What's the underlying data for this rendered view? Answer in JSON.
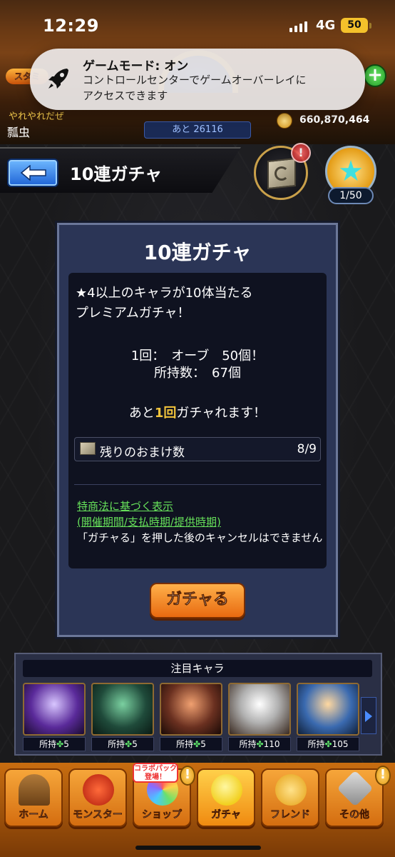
{
  "status_bar": {
    "time": "12:29",
    "network": "4G",
    "battery": "50"
  },
  "header": {
    "stamina_label": "スタミ",
    "subtitle": "やれやれだぜ",
    "username": "瓢虫",
    "remain_text": "あと 26116",
    "coins": "660,870,464"
  },
  "game_mode_banner": {
    "title": "ゲームモード: オン",
    "line1": "コントロールセンターでゲームオーバーレイに",
    "line2": "アクセスできます"
  },
  "title_bar": {
    "title": "10連ガチャ",
    "box_badge": "!",
    "star_count": "1/50"
  },
  "panel": {
    "title": "10連ガチャ",
    "desc_line1": "★4以上のキャラが10体当たる",
    "desc_line2": "プレミアムガチャ！",
    "cost_line": "1回：　オーブ　50個！",
    "owned_line": "所持数：　67個",
    "remaining_prefix": "あと",
    "remaining_count": "1回",
    "remaining_suffix": "ガチャれます！",
    "bonus_label": "残りのおまけ数",
    "bonus_value": "8/9",
    "legal_link1": "特商法に基づく表示",
    "legal_link2": "(開催期間/支払時期/提供時期)",
    "cancel_note": "「ガチャる」を押した後のキャンセルはできません",
    "gacha_button": "ガチャる"
  },
  "featured": {
    "title": "注目キャラ",
    "cards": [
      {
        "prefix": "所持",
        "clover": "✤",
        "count": "5"
      },
      {
        "prefix": "所持",
        "clover": "✤",
        "count": "5"
      },
      {
        "prefix": "所持",
        "clover": "✤",
        "count": "5"
      },
      {
        "prefix": "所持",
        "clover": "✤",
        "count": "110"
      },
      {
        "prefix": "所持",
        "clover": "✤",
        "count": "105"
      }
    ]
  },
  "bottom_nav": {
    "items": [
      {
        "label": "ホーム",
        "icon": "home-icon"
      },
      {
        "label": "モンスター",
        "icon": "monster-icon"
      },
      {
        "label": "ショップ",
        "icon": "shop-icon"
      },
      {
        "label": "ガチャ",
        "icon": "gacha-icon"
      },
      {
        "label": "フレンド",
        "icon": "friend-icon"
      },
      {
        "label": "その他",
        "icon": "other-icon"
      }
    ],
    "collab_badge_line1": "コラボパック",
    "collab_badge_line2": "登場！",
    "alert": "!"
  },
  "colors": {
    "accent_orange": "#e86a10",
    "highlight_yellow": "#f2c43c",
    "link_green": "#66e05a",
    "panel_blue": "#2b3556"
  }
}
